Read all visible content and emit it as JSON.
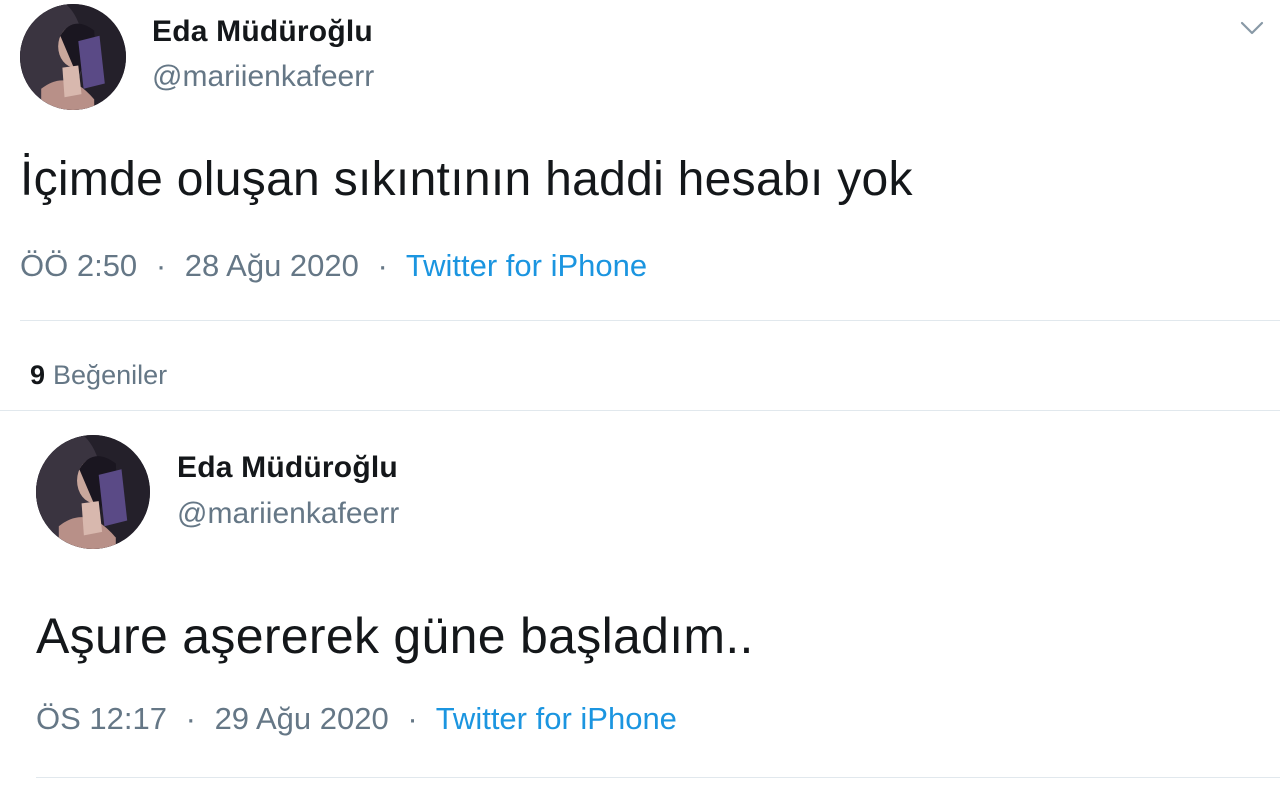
{
  "tweets": [
    {
      "display_name": "Eda Müdüroğlu",
      "handle": "@mariienkafeerr",
      "text": "İçimde oluşan sıkıntının haddi hesabı yok",
      "time": "ÖÖ 2:50",
      "date": "28 Ağu 2020",
      "source": "Twitter for iPhone",
      "separator": "·",
      "avatar_icon": "profile-photo",
      "menu_icon": "chevron-down-icon"
    },
    {
      "display_name": "Eda Müdüroğlu",
      "handle": "@mariienkafeerr",
      "text": "Aşure aşererek güne başladım..",
      "time": "ÖS 12:17",
      "date": "29 Ağu 2020",
      "source": "Twitter for iPhone",
      "separator": "·",
      "avatar_icon": "profile-photo"
    }
  ],
  "likes": {
    "count": "9",
    "label": "Beğeniler"
  },
  "colors": {
    "text_primary": "#14171a",
    "text_secondary": "#657786",
    "link": "#1b95e0",
    "divider": "#e1e8ed"
  }
}
